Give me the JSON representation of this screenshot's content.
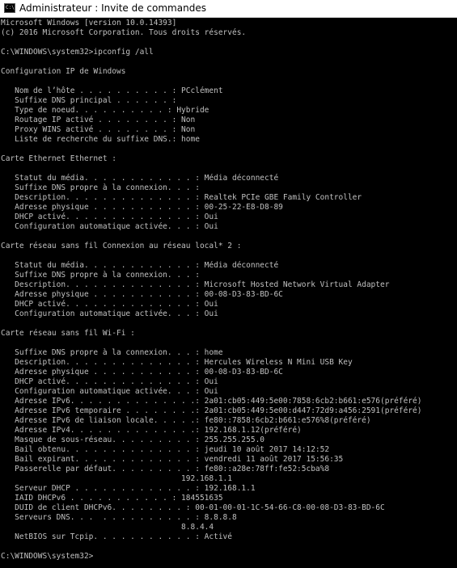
{
  "window": {
    "title": "Administrateur : Invite de commandes",
    "icon": "cmd-icon"
  },
  "colors": {
    "console_bg": "#000000",
    "console_text": "#c0c0c0",
    "titlebar_bg": "#ffffff"
  },
  "console": {
    "lines": [
      "Microsoft Windows [version 10.0.14393]",
      "(c) 2016 Microsoft Corporation. Tous droits réservés.",
      "",
      "C:\\WINDOWS\\system32>ipconfig /all",
      "",
      "Configuration IP de Windows",
      "",
      "   Nom de l’hôte . . . . . . . . . . : PCclément",
      "   Suffixe DNS principal . . . . . . :",
      "   Type de noeud. . . . . . . . . . : Hybride",
      "   Routage IP activé . . . . . . . . : Non",
      "   Proxy WINS activé . . . . . . . . : Non",
      "   Liste de recherche du suffixe DNS.: home",
      "",
      "Carte Ethernet Ethernet :",
      "",
      "   Statut du média. . . . . . . . . . . . : Média déconnecté",
      "   Suffixe DNS propre à la connexion. . . :",
      "   Description. . . . . . . . . . . . . . : Realtek PCIe GBE Family Controller",
      "   Adresse physique . . . . . . . . . . . : 00-25-22-E8-D8-89",
      "   DHCP activé. . . . . . . . . . . . . . : Oui",
      "   Configuration automatique activée. . . : Oui",
      "",
      "Carte réseau sans fil Connexion au réseau local* 2 :",
      "",
      "   Statut du média. . . . . . . . . . . . : Média déconnecté",
      "   Suffixe DNS propre à la connexion. . . :",
      "   Description. . . . . . . . . . . . . . : Microsoft Hosted Network Virtual Adapter",
      "   Adresse physique . . . . . . . . . . . : 00-08-D3-83-BD-6C",
      "   DHCP activé. . . . . . . . . . . . . . : Oui",
      "   Configuration automatique activée. . . : Oui",
      "",
      "Carte réseau sans fil Wi-Fi :",
      "",
      "   Suffixe DNS propre à la connexion. . . : home",
      "   Description. . . . . . . . . . . . . . : Hercules Wireless N Mini USB Key",
      "   Adresse physique . . . . . . . . . . . : 00-08-D3-83-BD-6C",
      "   DHCP activé. . . . . . . . . . . . . . : Oui",
      "   Configuration automatique activée. . . : Oui",
      "   Adresse IPv6. . . . . . . . . . . . . .: 2a01:cb05:449:5e00:7858:6cb2:b661:e576(préféré)",
      "   Adresse IPv6 temporaire . . . . . . . .: 2a01:cb05:449:5e00:d447:72d9:a456:2591(préféré)",
      "   Adresse IPv6 de liaison locale. . . . .: fe80::7858:6cb2:b661:e576%8(préféré)",
      "   Adresse IPv4. . . . . . . . . . . . . .: 192.168.1.12(préféré)",
      "   Masque de sous-réseau. . . . . . . . . : 255.255.255.0",
      "   Bail obtenu. . . . . . . . . . . . . . : jeudi 10 août 2017 14:12:52",
      "   Bail expirant. . . . . . . . . . . . . : vendredi 11 août 2017 15:56:35",
      "   Passerelle par défaut. . . . . . . . . : fe80::a28e:78ff:fe52:5cba%8",
      "                                       192.168.1.1",
      "   Serveur DHCP . . . . . . . . . . . . . : 192.168.1.1",
      "   IAID DHCPv6 . . . . . . . . . . . : 184551635",
      "   DUID de client DHCPv6. . . . . . . . : 00-01-00-01-1C-54-66-C8-00-08-D3-83-BD-6C",
      "   Serveurs DNS. . .  . . . . . . . . . . : 8.8.8.8",
      "                                       8.8.4.4",
      "   NetBIOS sur Tcpip. . . . . . . . . . . : Activé",
      "",
      "C:\\WINDOWS\\system32>"
    ]
  }
}
